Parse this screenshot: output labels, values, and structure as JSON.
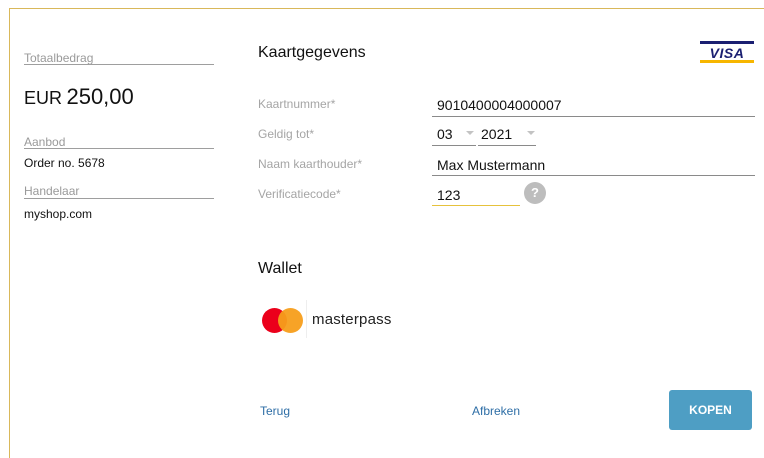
{
  "summary": {
    "total_label": "Totaalbedrag",
    "currency": "EUR",
    "amount": "250,00",
    "offer_label": "Aanbod",
    "offer_value": "Order no. 5678",
    "merchant_label": "Handelaar",
    "merchant_value": "myshop.com"
  },
  "card": {
    "title": "Kaartgegevens",
    "brand": "VISA",
    "number_label": "Kaartnummer*",
    "number_value": "9010400004000007",
    "expiry_label": "Geldig tot*",
    "expiry_month": "03",
    "expiry_year": "2021",
    "holder_label": "Naam kaarthouder*",
    "holder_value": "Max Mustermann",
    "cvc_label": "Verificatiecode*",
    "cvc_value": "123",
    "help_symbol": "?"
  },
  "wallet": {
    "title": "Wallet",
    "provider": "masterpass"
  },
  "actions": {
    "back": "Terug",
    "cancel": "Afbreken",
    "buy": "KOPEN"
  },
  "colors": {
    "accent_border": "#d9b85a",
    "button": "#4e9ec4",
    "link": "#2e6ea6",
    "focus_underline": "#e6c23c"
  }
}
